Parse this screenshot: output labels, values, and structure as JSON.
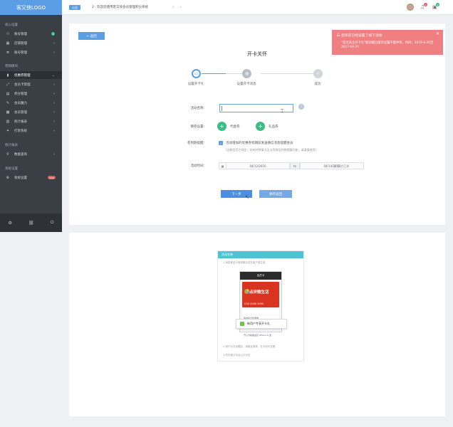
{
  "sidebar": {
    "logo": "客又侠LOGO",
    "sections": [
      {
        "title": "核心设置"
      },
      {
        "title": "营销模块"
      },
      {
        "title": "统计报表"
      },
      {
        "title": "系统设置"
      }
    ],
    "items": [
      {
        "label": "账号管理",
        "icon": "user-icon",
        "badge": "1"
      },
      {
        "label": "店铺管理",
        "icon": "store-icon"
      },
      {
        "label": "账号管理",
        "icon": "list-icon"
      },
      {
        "label": "优惠券管理",
        "icon": "coupon-icon"
      },
      {
        "label": "会员卡管理",
        "icon": "card-icon"
      },
      {
        "label": "积分管理",
        "icon": "points-icon"
      },
      {
        "label": "会员魔力",
        "icon": "magic-icon"
      },
      {
        "label": "会员管理",
        "icon": "members-icon"
      },
      {
        "label": "统计报表",
        "icon": "chart-icon"
      },
      {
        "label": "打赏系统",
        "icon": "gift-icon"
      },
      {
        "label": "数据查询",
        "icon": "search-icon"
      },
      {
        "label": "系统设置",
        "icon": "settings-icon",
        "badge": "new"
      }
    ]
  },
  "header": {
    "tag": "公告",
    "marquee": "2 · 欢迎您使用客又侠会员管理积分系统",
    "badges": [
      "9",
      "3"
    ]
  },
  "main": {
    "back_label": "← 返回",
    "title": "开卡关怀",
    "steps": [
      {
        "label": "设置开卡礼"
      },
      {
        "label": "设置开卡消息"
      },
      {
        "label": "成功"
      }
    ],
    "form": {
      "name_label": "活动名称：",
      "gift_label": "赠卷设置：",
      "gift_options": [
        "代金券",
        "礼品券"
      ],
      "reminder_label": "卷到期提醒：",
      "reminder_text": "活动增加的优惠券到期前发送微信消息提醒会员",
      "reminder_note": "(因微信官方规定，如有特殊情况无法用微信到期提醒功能，请谨慎使用)",
      "time_label": "活动时间：",
      "date_start": "04/12/2016",
      "date_to": "to",
      "date_end": "04/14/2016",
      "date_hint": "该活动已关",
      "next_label": "下一步",
      "save_label": "保存返回"
    }
  },
  "alert": {
    "title": "您目前已经设置了如下活动",
    "body": "\"首次关注开卡礼\"新功能已提示设置不能冲突，时间：2016-4-20至2017-04-25"
  },
  "preview": {
    "header": "活动名称",
    "caption1": "1.消息推送卡券领取后将在客户端生成",
    "phone_title": "会员卡",
    "card_brand": "点评微生活",
    "card_number": "CSA 0000 0000",
    "row1": "我的积分优惠券",
    "row2": "开心卡随着会员 iPhone 6 送",
    "popup": "新用户专享开卡礼",
    "caption2": "2.用户点击查看后，领取优惠券，在卡包中查看",
    "caption3": "人员在微卡平台入口可见"
  }
}
